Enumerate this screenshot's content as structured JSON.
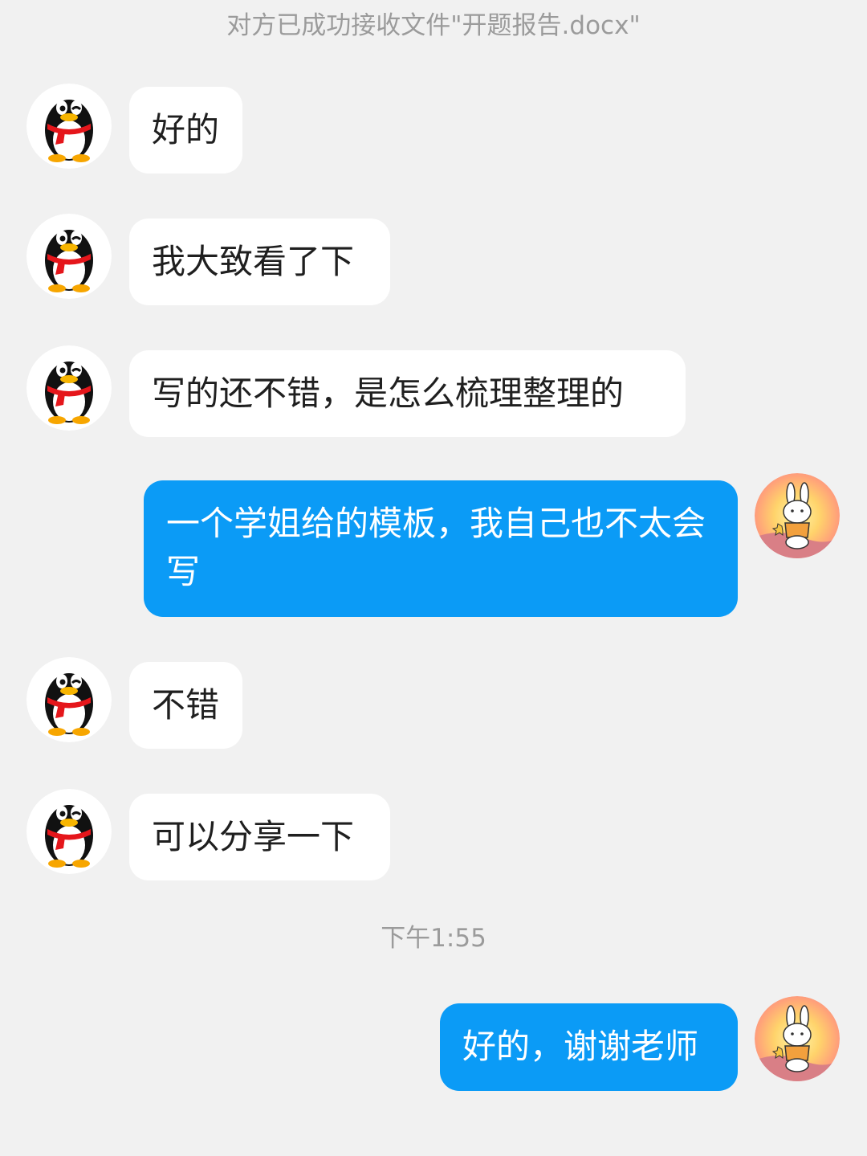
{
  "system_notice": "对方已成功接收文件\"开题报告.docx\"",
  "timestamp": "下午1:55",
  "colors": {
    "background": "#f1f1f1",
    "incoming_bubble": "#ffffff",
    "outgoing_bubble": "#0b9bf6",
    "system_text": "#9b9b9b"
  },
  "avatars": {
    "contact": "qq-penguin-avatar",
    "self": "bunny-sunset-avatar"
  },
  "messages": [
    {
      "sender": "contact",
      "text": "好的"
    },
    {
      "sender": "contact",
      "text": "我大致看了下"
    },
    {
      "sender": "contact",
      "text": "写的还不错，是怎么梳理整理的"
    },
    {
      "sender": "self",
      "text": "一个学姐给的模板，我自己也不太会写"
    },
    {
      "sender": "contact",
      "text": "不错"
    },
    {
      "sender": "contact",
      "text": "可以分享一下"
    },
    {
      "sender": "self",
      "text": "好的，谢谢老师"
    }
  ]
}
